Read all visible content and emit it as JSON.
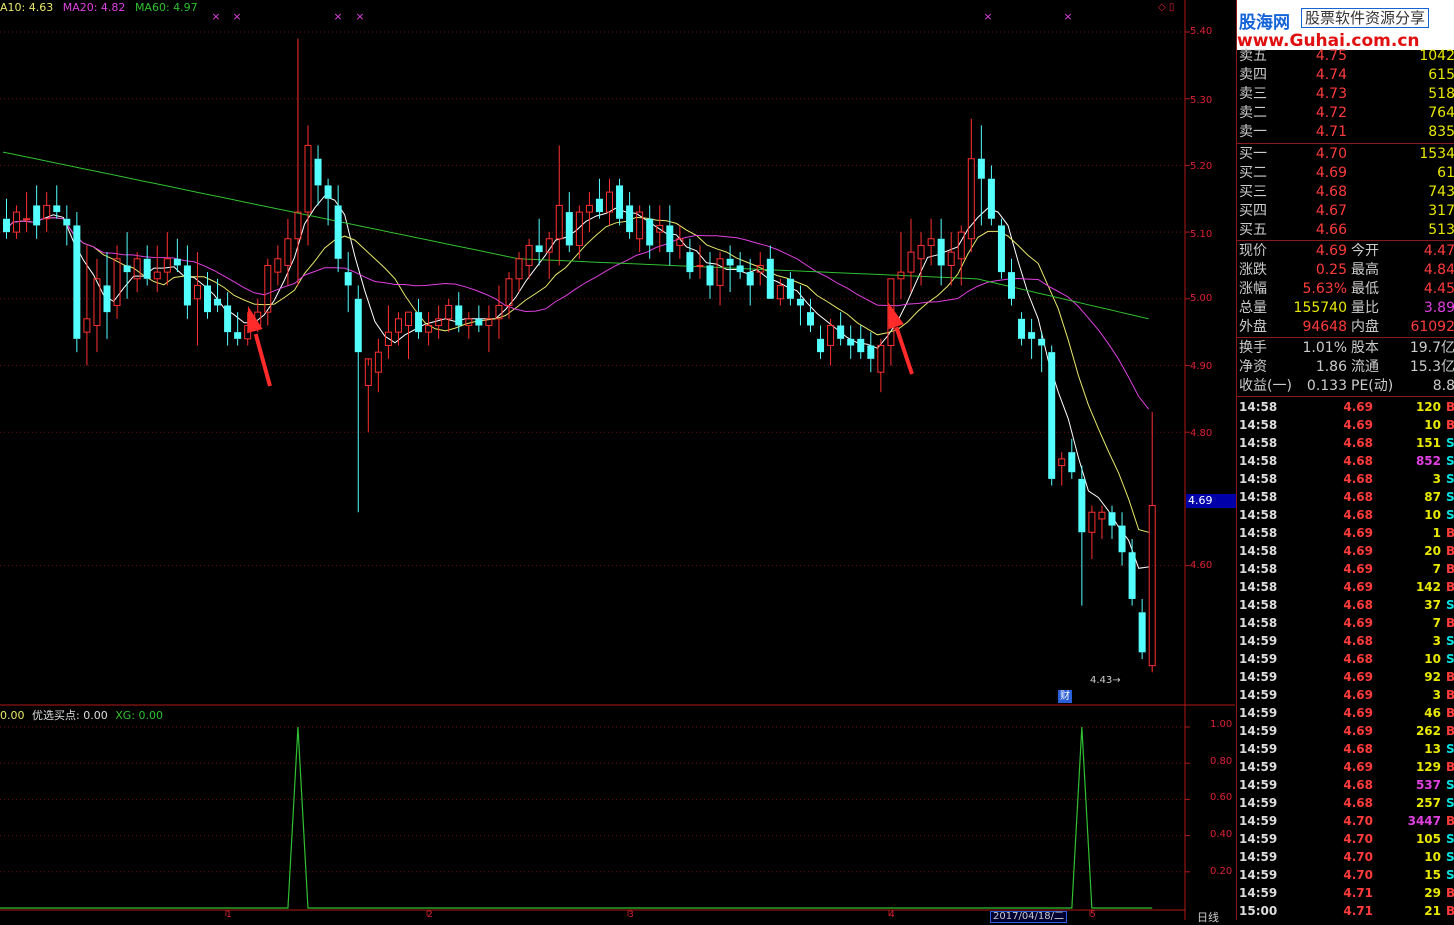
{
  "legend": {
    "ma10": "A10: 4.63",
    "ma20": "MA20: 4.82",
    "ma60": "MA60: 4.97"
  },
  "indicator_legend": {
    "base": "0.00",
    "buy": "优选买点: 0.00",
    "xg": "XG: 0.00"
  },
  "colors": {
    "up": "#ff3030",
    "down": "#54ffff",
    "ma_short": "#ffffff",
    "ma10": "#e8e86a",
    "ma20": "#e040e0",
    "ma60": "#30c030",
    "indicator": "#30c030",
    "axis": "#b01a1a"
  },
  "price_axis": [
    "5.40",
    "5.30",
    "5.20",
    "5.10",
    "5.00",
    "4.90",
    "4.80",
    "4.60"
  ],
  "indicator_axis": [
    "1.00",
    "0.80",
    "0.60",
    "0.40",
    "0.20"
  ],
  "current_price_tag": "4.69",
  "low_label": "4.43",
  "badge": "财",
  "date_box": "2017/04/18/二",
  "period": "日线",
  "x_ticks": [
    "1",
    "2",
    "3",
    "4",
    "5"
  ],
  "top_icons": "◇ ▯",
  "chart_data": {
    "type": "candlestick",
    "ylim": [
      4.43,
      5.4
    ],
    "candles": [
      [
        5.12,
        5.15,
        5.09,
        5.1
      ],
      [
        5.1,
        5.14,
        5.09,
        5.13
      ],
      [
        5.12,
        5.16,
        5.1,
        5.12
      ],
      [
        5.14,
        5.17,
        5.09,
        5.11
      ],
      [
        5.12,
        5.16,
        5.1,
        5.14
      ],
      [
        5.14,
        5.17,
        5.12,
        5.13
      ],
      [
        5.12,
        5.14,
        5.08,
        5.11
      ],
      [
        5.11,
        5.13,
        4.92,
        4.94
      ],
      [
        4.95,
        5.08,
        4.9,
        4.97
      ],
      [
        4.96,
        5.06,
        4.92,
        5.03
      ],
      [
        5.02,
        5.07,
        4.94,
        4.98
      ],
      [
        4.99,
        5.08,
        4.97,
        5.06
      ],
      [
        5.05,
        5.1,
        5.0,
        5.04
      ],
      [
        5.03,
        5.07,
        5.01,
        5.06
      ],
      [
        5.06,
        5.08,
        5.02,
        5.03
      ],
      [
        5.03,
        5.08,
        5.01,
        5.04
      ],
      [
        5.04,
        5.1,
        5.02,
        5.06
      ],
      [
        5.06,
        5.09,
        5.04,
        5.05
      ],
      [
        5.05,
        5.08,
        4.97,
        4.99
      ],
      [
        5.0,
        5.07,
        4.93,
        5.02
      ],
      [
        5.02,
        5.04,
        4.97,
        4.98
      ],
      [
        5.0,
        5.03,
        4.98,
        4.99
      ],
      [
        4.99,
        5.01,
        4.93,
        4.95
      ],
      [
        4.95,
        4.98,
        4.93,
        4.94
      ],
      [
        4.94,
        4.98,
        4.93,
        4.96
      ],
      [
        4.96,
        5.0,
        4.95,
        4.98
      ],
      [
        4.98,
        5.06,
        4.96,
        5.05
      ],
      [
        5.04,
        5.08,
        5.02,
        5.06
      ],
      [
        5.05,
        5.12,
        5.02,
        5.09
      ],
      [
        5.09,
        5.39,
        5.02,
        5.13
      ],
      [
        5.13,
        5.26,
        5.08,
        5.23
      ],
      [
        5.21,
        5.23,
        5.14,
        5.17
      ],
      [
        5.17,
        5.18,
        5.11,
        5.15
      ],
      [
        5.14,
        5.17,
        5.04,
        5.06
      ],
      [
        5.04,
        5.07,
        4.98,
        5.02
      ],
      [
        5.0,
        5.02,
        4.68,
        4.92
      ],
      [
        4.87,
        4.9,
        4.8,
        4.91
      ],
      [
        4.89,
        4.94,
        4.86,
        4.92
      ],
      [
        4.93,
        4.99,
        4.91,
        4.95
      ],
      [
        4.95,
        4.98,
        4.93,
        4.97
      ],
      [
        4.96,
        4.98,
        4.91,
        4.98
      ],
      [
        4.98,
        5.0,
        4.94,
        4.95
      ],
      [
        4.95,
        4.98,
        4.93,
        4.96
      ],
      [
        4.96,
        4.99,
        4.94,
        4.97
      ],
      [
        4.97,
        5.0,
        4.95,
        4.99
      ],
      [
        4.99,
        5.01,
        4.95,
        4.96
      ],
      [
        4.96,
        4.98,
        4.94,
        4.97
      ],
      [
        4.97,
        4.99,
        4.95,
        4.96
      ],
      [
        4.96,
        4.99,
        4.92,
        4.97
      ],
      [
        4.97,
        5.02,
        4.94,
        4.99
      ],
      [
        4.99,
        5.04,
        4.97,
        5.03
      ],
      [
        5.03,
        5.07,
        5.01,
        5.06
      ],
      [
        5.05,
        5.09,
        5.03,
        5.08
      ],
      [
        5.08,
        5.12,
        5.05,
        5.07
      ],
      [
        5.07,
        5.1,
        5.03,
        5.09
      ],
      [
        5.09,
        5.23,
        5.05,
        5.14
      ],
      [
        5.13,
        5.16,
        5.07,
        5.08
      ],
      [
        5.08,
        5.14,
        5.06,
        5.13
      ],
      [
        5.13,
        5.16,
        5.1,
        5.14
      ],
      [
        5.15,
        5.18,
        5.12,
        5.13
      ],
      [
        5.13,
        5.18,
        5.11,
        5.16
      ],
      [
        5.17,
        5.18,
        5.11,
        5.12
      ],
      [
        5.14,
        5.16,
        5.09,
        5.1
      ],
      [
        5.09,
        5.14,
        5.07,
        5.13
      ],
      [
        5.12,
        5.14,
        5.06,
        5.08
      ],
      [
        5.1,
        5.14,
        5.07,
        5.11
      ],
      [
        5.11,
        5.14,
        5.05,
        5.07
      ],
      [
        5.08,
        5.11,
        5.06,
        5.09
      ],
      [
        5.07,
        5.09,
        5.03,
        5.04
      ],
      [
        5.05,
        5.08,
        5.03,
        5.05
      ],
      [
        5.05,
        5.07,
        5.0,
        5.02
      ],
      [
        5.02,
        5.07,
        4.99,
        5.06
      ],
      [
        5.06,
        5.08,
        5.01,
        5.05
      ],
      [
        5.05,
        5.07,
        5.03,
        5.04
      ],
      [
        5.04,
        5.06,
        4.99,
        5.02
      ],
      [
        5.04,
        5.07,
        5.02,
        5.05
      ],
      [
        5.06,
        5.08,
        5.01,
        5.0
      ],
      [
        5.0,
        5.03,
        4.99,
        5.02
      ],
      [
        5.03,
        5.04,
        4.99,
        5.0
      ],
      [
        5.0,
        5.02,
        4.96,
        4.99
      ],
      [
        4.98,
        5.0,
        4.95,
        4.96
      ],
      [
        4.94,
        4.96,
        4.91,
        4.92
      ],
      [
        4.93,
        4.97,
        4.9,
        4.96
      ],
      [
        4.96,
        4.98,
        4.93,
        4.94
      ],
      [
        4.94,
        4.96,
        4.91,
        4.93
      ],
      [
        4.94,
        4.96,
        4.91,
        4.92
      ],
      [
        4.93,
        4.95,
        4.89,
        4.91
      ],
      [
        4.89,
        4.94,
        4.86,
        4.93
      ],
      [
        4.93,
        5.03,
        4.9,
        5.03
      ],
      [
        5.03,
        5.1,
        5.0,
        5.04
      ],
      [
        5.04,
        5.12,
        5.01,
        5.07
      ],
      [
        5.06,
        5.1,
        5.02,
        5.08
      ],
      [
        5.08,
        5.12,
        5.05,
        5.09
      ],
      [
        5.09,
        5.12,
        5.02,
        5.05
      ],
      [
        5.05,
        5.1,
        5.02,
        5.07
      ],
      [
        5.06,
        5.11,
        5.02,
        5.1
      ],
      [
        5.09,
        5.27,
        5.07,
        5.21
      ],
      [
        5.21,
        5.26,
        5.11,
        5.18
      ],
      [
        5.18,
        5.2,
        5.11,
        5.12
      ],
      [
        5.11,
        5.12,
        5.03,
        5.04
      ],
      [
        5.04,
        5.06,
        4.99,
        5.0
      ],
      [
        4.97,
        4.98,
        4.93,
        4.94
      ],
      [
        4.95,
        4.97,
        4.91,
        4.94
      ],
      [
        4.94,
        4.95,
        4.89,
        4.93
      ],
      [
        4.92,
        4.93,
        4.72,
        4.73
      ],
      [
        4.75,
        4.77,
        4.72,
        4.76
      ],
      [
        4.77,
        4.79,
        4.73,
        4.74
      ],
      [
        4.73,
        4.75,
        4.54,
        4.65
      ],
      [
        4.65,
        4.69,
        4.61,
        4.68
      ],
      [
        4.67,
        4.69,
        4.64,
        4.68
      ],
      [
        4.68,
        4.69,
        4.64,
        4.66
      ],
      [
        4.66,
        4.68,
        4.6,
        4.62
      ],
      [
        4.62,
        4.64,
        4.54,
        4.55
      ],
      [
        4.53,
        4.55,
        4.46,
        4.47
      ],
      [
        4.45,
        4.83,
        4.44,
        4.69
      ]
    ],
    "buy_signals": [
      29,
      107
    ],
    "ma60_levels": [
      5.22,
      5.06,
      5.03,
      4.97
    ]
  },
  "quote": {
    "asks": [
      {
        "label": "卖五",
        "price": "4.75",
        "vol": "1042"
      },
      {
        "label": "卖四",
        "price": "4.74",
        "vol": "615"
      },
      {
        "label": "卖三",
        "price": "4.73",
        "vol": "518"
      },
      {
        "label": "卖二",
        "price": "4.72",
        "vol": "764"
      },
      {
        "label": "卖一",
        "price": "4.71",
        "vol": "835"
      }
    ],
    "bids": [
      {
        "label": "买一",
        "price": "4.70",
        "vol": "1534"
      },
      {
        "label": "买二",
        "price": "4.69",
        "vol": "61"
      },
      {
        "label": "买三",
        "price": "4.68",
        "vol": "743"
      },
      {
        "label": "买四",
        "price": "4.67",
        "vol": "317"
      },
      {
        "label": "买五",
        "price": "4.66",
        "vol": "513"
      }
    ],
    "stats": [
      {
        "l1": "现价",
        "v1": "4.69",
        "l2": "今开",
        "v2": "4.47",
        "c1": "red",
        "c2": "red"
      },
      {
        "l1": "涨跌",
        "v1": "0.25",
        "l2": "最高",
        "v2": "4.84",
        "c1": "red",
        "c2": "red"
      },
      {
        "l1": "涨幅",
        "v1": "5.63%",
        "l2": "最低",
        "v2": "4.45",
        "c1": "red",
        "c2": "red"
      },
      {
        "l1": "总量",
        "v1": "155740",
        "l2": "量比",
        "v2": "3.89",
        "c1": "yel",
        "c2": "mag"
      },
      {
        "l1": "外盘",
        "v1": "94648",
        "l2": "内盘",
        "v2": "61092",
        "c1": "red",
        "c2": "red"
      },
      {
        "l1": "换手",
        "v1": "1.01%",
        "l2": "股本",
        "v2": "19.7亿",
        "c1": "w",
        "c2": "w"
      },
      {
        "l1": "净资",
        "v1": "1.86",
        "l2": "流通",
        "v2": "15.3亿",
        "c1": "w",
        "c2": "w"
      },
      {
        "l1": "收益(一)",
        "v1": "0.133",
        "l2": "PE(动)",
        "v2": "8.8",
        "c1": "w",
        "c2": "w"
      }
    ],
    "ticks": [
      [
        "14:58",
        "4.69",
        "120",
        "B"
      ],
      [
        "14:58",
        "4.69",
        "10",
        "B"
      ],
      [
        "14:58",
        "4.68",
        "151",
        "S"
      ],
      [
        "14:58",
        "4.68",
        "852",
        "S"
      ],
      [
        "14:58",
        "4.68",
        "3",
        "S"
      ],
      [
        "14:58",
        "4.68",
        "87",
        "S"
      ],
      [
        "14:58",
        "4.68",
        "10",
        "S"
      ],
      [
        "14:58",
        "4.69",
        "1",
        "B"
      ],
      [
        "14:58",
        "4.69",
        "20",
        "B"
      ],
      [
        "14:58",
        "4.69",
        "7",
        "B"
      ],
      [
        "14:58",
        "4.69",
        "142",
        "B"
      ],
      [
        "14:58",
        "4.68",
        "37",
        "S"
      ],
      [
        "14:58",
        "4.69",
        "7",
        "B"
      ],
      [
        "14:59",
        "4.68",
        "3",
        "S"
      ],
      [
        "14:59",
        "4.68",
        "10",
        "S"
      ],
      [
        "14:59",
        "4.69",
        "92",
        "B"
      ],
      [
        "14:59",
        "4.69",
        "3",
        "B"
      ],
      [
        "14:59",
        "4.69",
        "46",
        "B"
      ],
      [
        "14:59",
        "4.69",
        "262",
        "B"
      ],
      [
        "14:59",
        "4.68",
        "13",
        "S"
      ],
      [
        "14:59",
        "4.69",
        "129",
        "B"
      ],
      [
        "14:59",
        "4.68",
        "537",
        "S"
      ],
      [
        "14:59",
        "4.68",
        "257",
        "S"
      ],
      [
        "14:59",
        "4.70",
        "3447",
        "B"
      ],
      [
        "14:59",
        "4.70",
        "105",
        "S"
      ],
      [
        "14:59",
        "4.70",
        "10",
        "S"
      ],
      [
        "14:59",
        "4.70",
        "15",
        "S"
      ],
      [
        "14:59",
        "4.71",
        "29",
        "B"
      ],
      [
        "15:00",
        "4.71",
        "21",
        "B"
      ]
    ]
  },
  "logo": {
    "brand": "股海网",
    "tag": "股票软件资源分享",
    "url": "www.Guhai.com.cn"
  }
}
